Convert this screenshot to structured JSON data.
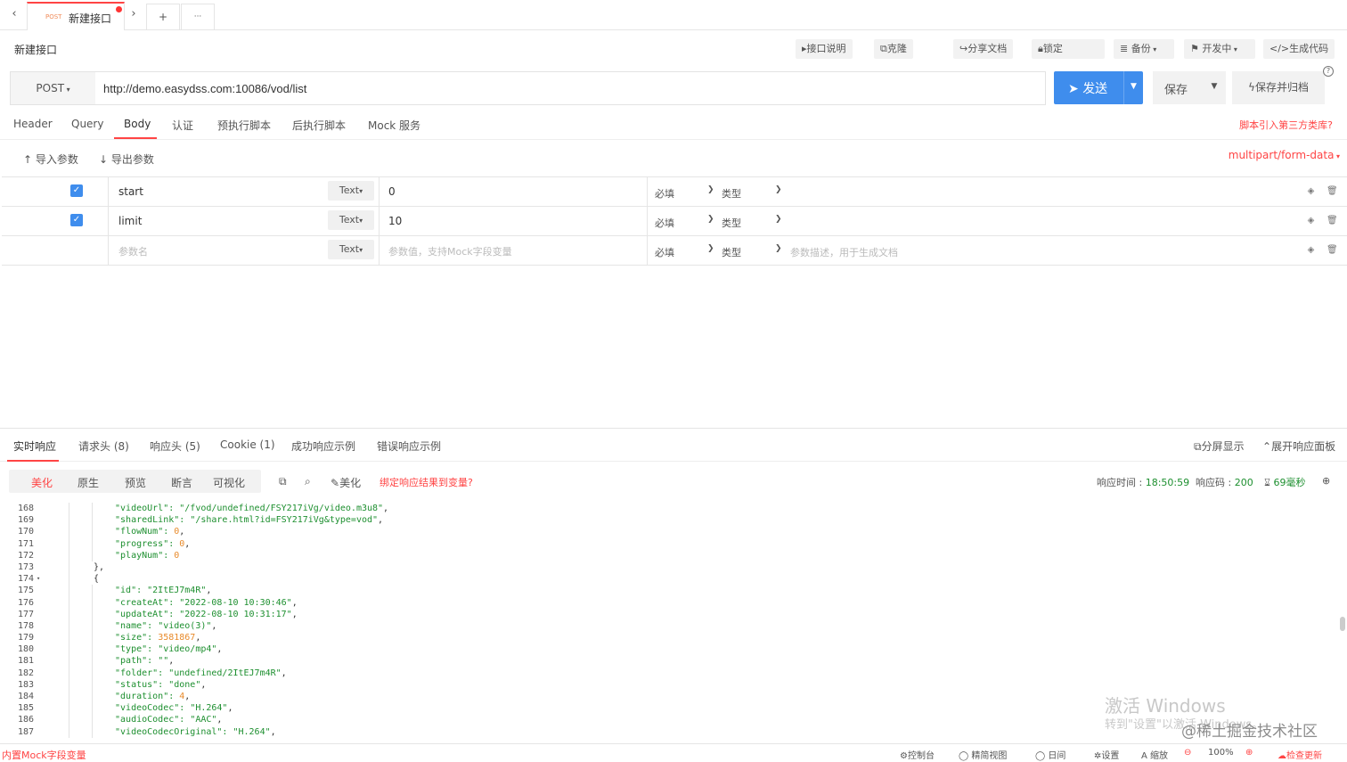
{
  "tabbar": {
    "back": "‹",
    "forward": "›",
    "active_tab": {
      "method": "POST",
      "name": "新建接口"
    },
    "add": "+",
    "more": "···"
  },
  "toolbar": {
    "title": "新建接口",
    "doc": "接口说明",
    "clone": "克隆",
    "share": "分享文档",
    "lock": "锁定",
    "backup": "备份",
    "status": "开发中",
    "gen_code": "生成代码"
  },
  "request": {
    "method": "POST",
    "url": "http://demo.easydss.com:10086/vod/list",
    "send": "发送",
    "save": "保存",
    "save_archive": "保存并归档",
    "help": "?"
  },
  "subtabs": [
    "Header",
    "Query",
    "Body",
    "认证",
    "预执行脚本",
    "后执行脚本",
    "Mock 服务"
  ],
  "third_party": "脚本引入第三方类库?",
  "param_actions": {
    "import": "导入参数",
    "export": "导出参数",
    "form_type": "multipart/form-data"
  },
  "params": [
    {
      "checked": true,
      "name": "start",
      "type": "Text",
      "value": "0",
      "required": "必填",
      "kind": "类型",
      "desc": ""
    },
    {
      "checked": true,
      "name": "limit",
      "type": "Text",
      "value": "10",
      "required": "必填",
      "kind": "类型",
      "desc": ""
    },
    {
      "checked": false,
      "name_placeholder": "参数名",
      "type": "Text",
      "value_placeholder": "参数值，支持Mock字段变量",
      "required": "必填",
      "kind": "类型",
      "desc_placeholder": "参数描述，用于生成文档"
    }
  ],
  "response_tabs": [
    "实时响应",
    "请求头 (8)",
    "响应头 (5)",
    "Cookie (1)",
    "成功响应示例",
    "错误响应示例"
  ],
  "response_right": {
    "split": "分屏显示",
    "expand": "展开响应面板"
  },
  "view_modes": [
    "美化",
    "原生",
    "预览",
    "断言",
    "可视化"
  ],
  "view_tools": {
    "beautify": "美化",
    "bind": "绑定响应结果到变量?"
  },
  "response_meta": {
    "time_label": "响应时间 : ",
    "time": "18:50:59",
    "code_label": "响应码 : ",
    "code": "200",
    "duration": "69毫秒"
  },
  "code_lines": [
    {
      "n": "168",
      "indent": 2,
      "key": "videoUrl",
      "val": "\"/fvod/undefined/FSY217iVg/video.m3u8\"",
      "vt": "s",
      "comma": true
    },
    {
      "n": "169",
      "indent": 2,
      "key": "sharedLink",
      "val": "\"/share.html?id=FSY217iVg&type=vod\"",
      "vt": "s",
      "comma": true
    },
    {
      "n": "170",
      "indent": 2,
      "key": "flowNum",
      "val": "0",
      "vt": "n",
      "comma": true
    },
    {
      "n": "171",
      "indent": 2,
      "key": "progress",
      "val": "0",
      "vt": "n",
      "comma": true
    },
    {
      "n": "172",
      "indent": 2,
      "key": "playNum",
      "val": "0",
      "vt": "n",
      "comma": false
    },
    {
      "n": "173",
      "indent": 1,
      "raw": "},"
    },
    {
      "n": "174",
      "indent": 1,
      "raw": "{",
      "fold": true
    },
    {
      "n": "175",
      "indent": 2,
      "key": "id",
      "val": "\"2ItEJ7m4R\"",
      "vt": "s",
      "comma": true
    },
    {
      "n": "176",
      "indent": 2,
      "key": "createAt",
      "val": "\"2022-08-10 10:30:46\"",
      "vt": "s",
      "comma": true
    },
    {
      "n": "177",
      "indent": 2,
      "key": "updateAt",
      "val": "\"2022-08-10 10:31:17\"",
      "vt": "s",
      "comma": true
    },
    {
      "n": "178",
      "indent": 2,
      "key": "name",
      "val": "\"video(3)\"",
      "vt": "s",
      "comma": true
    },
    {
      "n": "179",
      "indent": 2,
      "key": "size",
      "val": "3581867",
      "vt": "n",
      "comma": true
    },
    {
      "n": "180",
      "indent": 2,
      "key": "type",
      "val": "\"video/mp4\"",
      "vt": "s",
      "comma": true
    },
    {
      "n": "181",
      "indent": 2,
      "key": "path",
      "val": "\"\"",
      "vt": "s",
      "comma": true
    },
    {
      "n": "182",
      "indent": 2,
      "key": "folder",
      "val": "\"undefined/2ItEJ7m4R\"",
      "vt": "s",
      "comma": true
    },
    {
      "n": "183",
      "indent": 2,
      "key": "status",
      "val": "\"done\"",
      "vt": "s",
      "comma": true
    },
    {
      "n": "184",
      "indent": 2,
      "key": "duration",
      "val": "4",
      "vt": "n",
      "comma": true
    },
    {
      "n": "185",
      "indent": 2,
      "key": "videoCodec",
      "val": "\"H.264\"",
      "vt": "s",
      "comma": true
    },
    {
      "n": "186",
      "indent": 2,
      "key": "audioCodec",
      "val": "\"AAC\"",
      "vt": "s",
      "comma": true
    },
    {
      "n": "187",
      "indent": 2,
      "key": "videoCodecOriginal",
      "val": "\"H.264\"",
      "vt": "s",
      "comma": true
    }
  ],
  "watermark": {
    "line1": "激活 Windows",
    "line2": "转到\"设置\"以激活 Windows。",
    "brand": "@稀土掘金技术社区"
  },
  "statusbar": {
    "mock_var": "内置Mock字段变量",
    "console": "控制台",
    "simple_view": "精简视图",
    "night": "日间",
    "settings": "设置",
    "zoom": "缩放",
    "zoom_level": "100%",
    "update": "检查更新"
  },
  "colors": {
    "accent": "#3f8ded",
    "brand_red": "#ff4444",
    "json_green": "#1d8f2f",
    "json_number": "#e88a2a"
  }
}
